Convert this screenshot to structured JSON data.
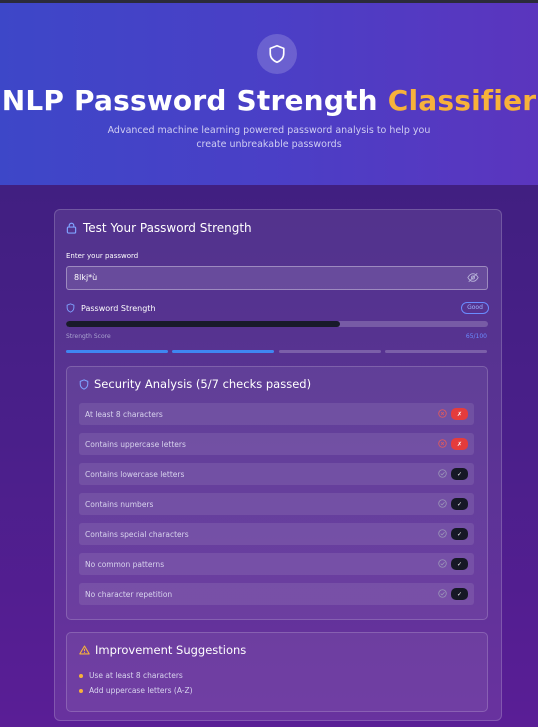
{
  "header": {
    "title_main": "NLP Password Strength",
    "title_accent": "Classifier",
    "subtitle": "Advanced machine learning powered password analysis to help you create unbreakable passwords",
    "icon": "shield-icon"
  },
  "tester": {
    "title": "Test Your Password Strength",
    "title_icon": "lock-icon",
    "input_label": "Enter your password",
    "password_value": "8lkj*ù",
    "visibility_icon": "eye-off-icon",
    "strength_label": "Password Strength",
    "strength_badge": "Good",
    "score_label": "Strength Score",
    "score_text": "65/100",
    "score_percent": 65,
    "segments_on": 2,
    "segments_total": 4
  },
  "security": {
    "title": "Security Analysis (5/7 checks passed)",
    "checks": [
      {
        "label": "At least 8 characters",
        "passed": false,
        "mark": "✗"
      },
      {
        "label": "Contains uppercase letters",
        "passed": false,
        "mark": "✗"
      },
      {
        "label": "Contains lowercase letters",
        "passed": true,
        "mark": "✓"
      },
      {
        "label": "Contains numbers",
        "passed": true,
        "mark": "✓"
      },
      {
        "label": "Contains special characters",
        "passed": true,
        "mark": "✓"
      },
      {
        "label": "No common patterns",
        "passed": true,
        "mark": "✓"
      },
      {
        "label": "No character repetition",
        "passed": true,
        "mark": "✓"
      }
    ]
  },
  "suggestions": {
    "title": "Improvement Suggestions",
    "items": [
      "Use at least 8 characters",
      "Add uppercase letters (A-Z)"
    ]
  },
  "colors": {
    "accent": "#f7b23a",
    "fail": "#e53c3c",
    "pass": "#161826",
    "bar": "#3f86f2"
  }
}
